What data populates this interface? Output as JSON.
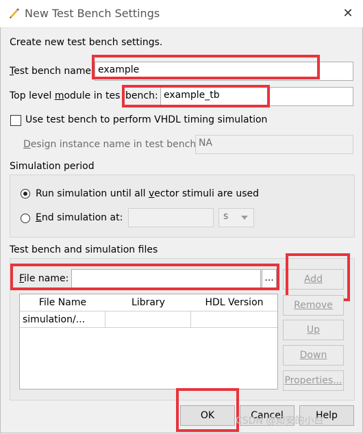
{
  "window": {
    "title": "New Test Bench Settings",
    "close_symbol": "✕"
  },
  "intro": "Create new test bench settings.",
  "test_bench_name": {
    "label_pre": "",
    "label_u": "T",
    "label_post": "est bench name:",
    "value": "example"
  },
  "top_level_module": {
    "label_pre": "Top level ",
    "label_u": "m",
    "label_post": "odule in tes",
    "overlap_label": "bench:",
    "value": "example_tb"
  },
  "vhdl_timing": {
    "label": "Use test bench to perform VHDL timing simulation",
    "checked": false
  },
  "design_instance": {
    "label_pre": "",
    "label_u": "D",
    "label_post": "esign instance name in test bench:",
    "value": "NA"
  },
  "simulation_period": {
    "title": "Simulation period",
    "run_option": {
      "label_pre": "Run simulation until all ",
      "label_u": "v",
      "label_post": "ector stimuli are used",
      "selected": true
    },
    "end_option": {
      "label_pre": "",
      "label_u": "E",
      "label_post": "nd simulation at:",
      "selected": false
    },
    "end_value": "",
    "unit": "s"
  },
  "files_section": {
    "title": "Test bench and simulation files",
    "file_name_label_pre": "",
    "file_name_label_u": "F",
    "file_name_label_post": "ile name:",
    "file_name_value": "",
    "browse_label": "...",
    "columns": [
      "File Name",
      "Library",
      "HDL Version"
    ],
    "rows": [
      {
        "file": "simulation/...",
        "library": "",
        "hdl": ""
      }
    ],
    "buttons": {
      "add": "Add",
      "remove": "Remove",
      "up": "Up",
      "down": "Down",
      "properties": "Properties..."
    }
  },
  "footer": {
    "ok": "OK",
    "cancel": "Cancel",
    "help": "Help"
  },
  "watermark": "CSDN @知安的小白"
}
